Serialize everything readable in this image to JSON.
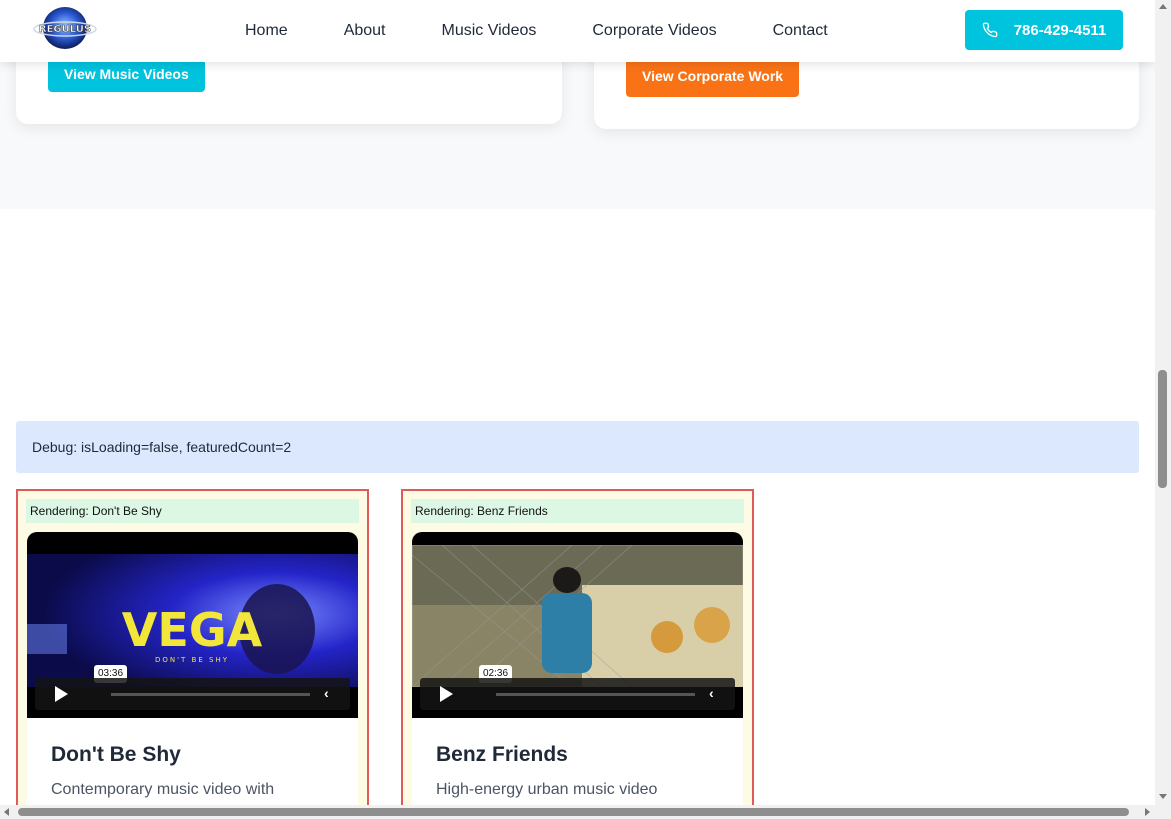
{
  "header": {
    "logo_text": "REGULUS",
    "nav": [
      "Home",
      "About",
      "Music Videos",
      "Corporate Videos",
      "Contact"
    ],
    "phone": "786-429-4511"
  },
  "services": {
    "music_button": "View Music Videos",
    "corporate_button": "View Corporate Work"
  },
  "debug": "Debug: isLoading=false, featuredCount=2",
  "videos": [
    {
      "render_label": "Rendering: Don't Be Shy",
      "time": "03:36",
      "thumb_title": "VEGA",
      "thumb_subtitle": "DON'T BE SHY",
      "title": "Don't Be Shy",
      "description": "Contemporary music video with"
    },
    {
      "render_label": "Rendering: Benz Friends",
      "time": "02:36",
      "title": "Benz Friends",
      "description": "High-energy urban music video"
    }
  ],
  "colors": {
    "accent": "#00c3de",
    "orange": "#f97316",
    "debug_bg": "#dbe8fe",
    "card_border": "#e05a5a"
  }
}
